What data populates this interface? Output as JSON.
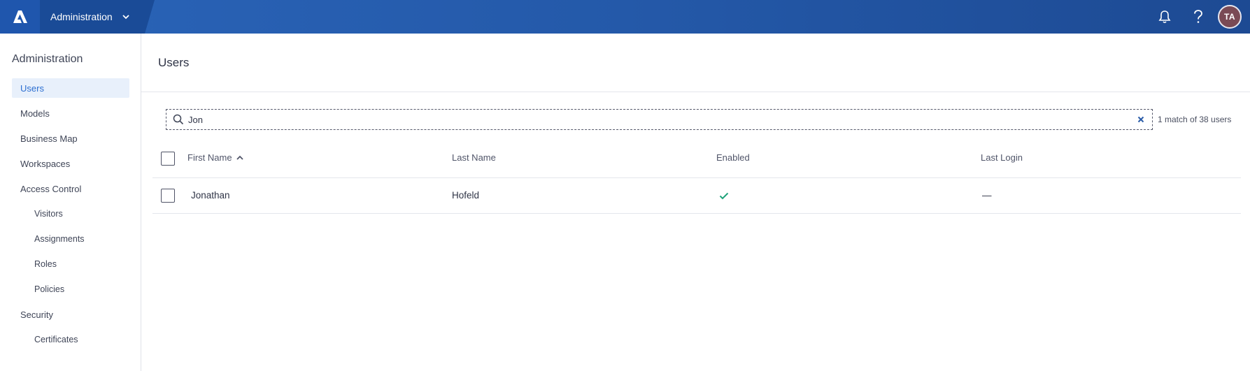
{
  "header": {
    "app_name": "Administration",
    "avatar_initials": "TA"
  },
  "sidebar": {
    "title": "Administration",
    "items": [
      {
        "label": "Users",
        "active": true,
        "level": 0
      },
      {
        "label": "Models",
        "active": false,
        "level": 0
      },
      {
        "label": "Business Map",
        "active": false,
        "level": 0
      },
      {
        "label": "Workspaces",
        "active": false,
        "level": 0
      },
      {
        "label": "Access Control",
        "active": false,
        "level": 0
      },
      {
        "label": "Visitors",
        "active": false,
        "level": 1
      },
      {
        "label": "Assignments",
        "active": false,
        "level": 1
      },
      {
        "label": "Roles",
        "active": false,
        "level": 1
      },
      {
        "label": "Policies",
        "active": false,
        "level": 1
      },
      {
        "label": "Security",
        "active": false,
        "level": 0
      },
      {
        "label": "Certificates",
        "active": false,
        "level": 1
      }
    ]
  },
  "main": {
    "title": "Users",
    "search": {
      "value": "Jon",
      "placeholder": ""
    },
    "match_count": "1 match of 38 users",
    "table": {
      "columns": [
        "First Name",
        "Last Name",
        "Enabled",
        "Last Login"
      ],
      "sort_column": "First Name",
      "sort_direction": "ascending",
      "rows": [
        {
          "first_name": "Jonathan",
          "last_name": "Hofeld",
          "enabled": true,
          "last_login": "—"
        }
      ]
    }
  },
  "colors": {
    "topbar": "#2459a9",
    "accent": "#2d6fd1",
    "active_bg": "#e8f0fb",
    "check": "#1fa37a"
  },
  "icons": {
    "logo": "brand-logo-icon",
    "dropdown": "chevron-down-icon",
    "notifications": "bell-icon",
    "help": "question-icon",
    "search": "search-icon",
    "clear": "close-icon",
    "sort": "sort-ascending-icon",
    "enabled": "checkmark-icon"
  }
}
